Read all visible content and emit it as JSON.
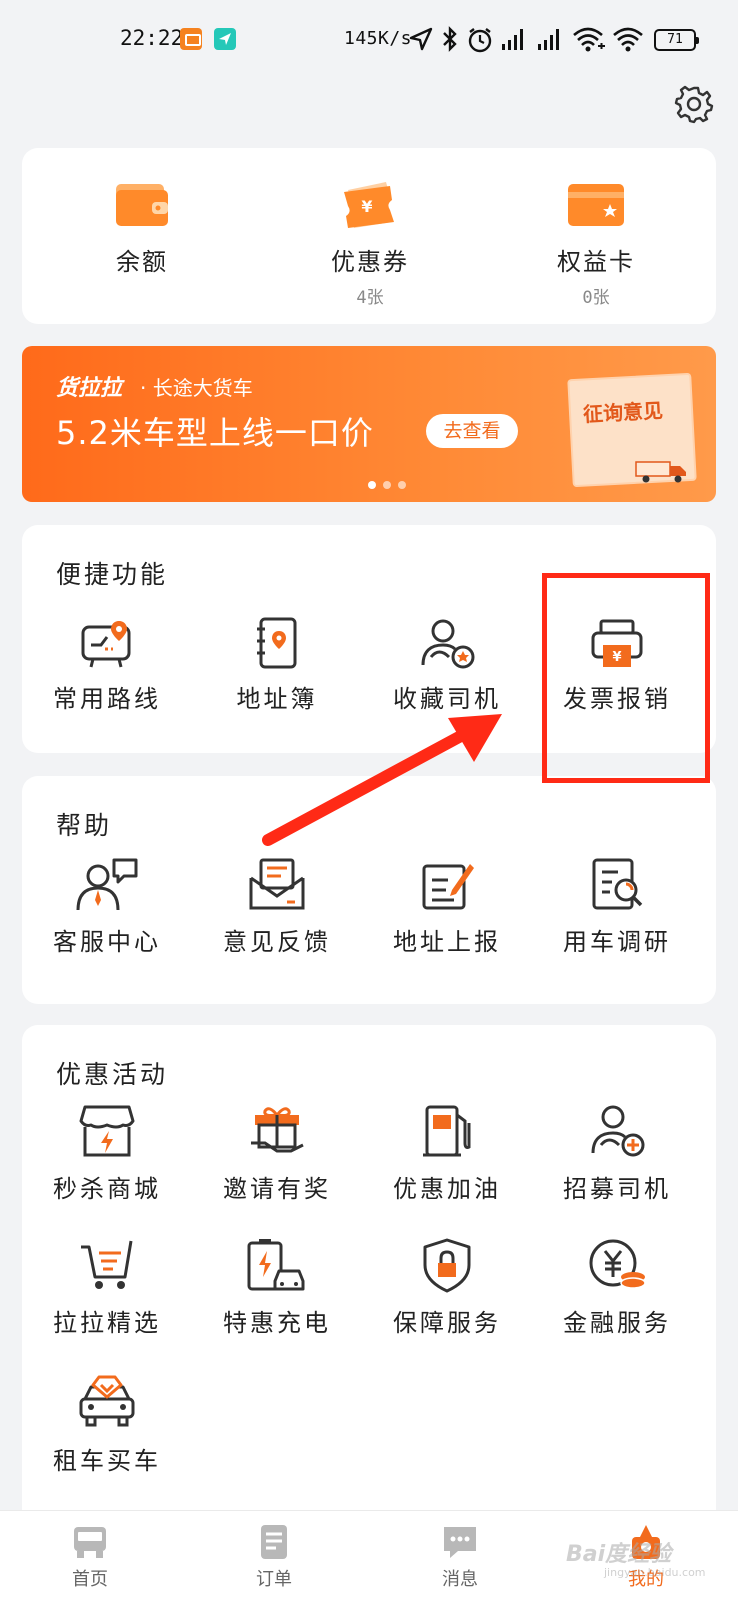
{
  "status_bar": {
    "time": "22:22",
    "net_speed": "145K/s",
    "battery": "71"
  },
  "wallet": {
    "items": [
      {
        "label": "余额",
        "sub": ""
      },
      {
        "label": "优惠券",
        "sub": "4张"
      },
      {
        "label": "权益卡",
        "sub": "0张"
      }
    ]
  },
  "banner": {
    "brand": "货拉拉",
    "subtitle": "· 长途大货车",
    "title": "5.2米车型上线一口价",
    "button": "去查看",
    "doc_text": "征询意见"
  },
  "quick": {
    "title": "便捷功能",
    "items": [
      {
        "label": "常用路线",
        "icon": "route-map-icon"
      },
      {
        "label": "地址簿",
        "icon": "address-book-icon"
      },
      {
        "label": "收藏司机",
        "icon": "favorite-driver-icon"
      },
      {
        "label": "发票报销",
        "icon": "invoice-printer-icon"
      }
    ]
  },
  "help": {
    "title": "帮助",
    "items": [
      {
        "label": "客服中心",
        "icon": "customer-service-icon"
      },
      {
        "label": "意见反馈",
        "icon": "feedback-envelope-icon"
      },
      {
        "label": "地址上报",
        "icon": "address-report-icon"
      },
      {
        "label": "用车调研",
        "icon": "survey-icon"
      }
    ]
  },
  "promo": {
    "title": "优惠活动",
    "items": [
      {
        "label": "秒杀商城",
        "icon": "flash-sale-store-icon"
      },
      {
        "label": "邀请有奖",
        "icon": "gift-icon"
      },
      {
        "label": "优惠加油",
        "icon": "fuel-pump-icon"
      },
      {
        "label": "招募司机",
        "icon": "recruit-driver-icon"
      },
      {
        "label": "拉拉精选",
        "icon": "shopping-cart-icon"
      },
      {
        "label": "特惠充电",
        "icon": "ev-charge-icon"
      },
      {
        "label": "保障服务",
        "icon": "shield-lock-icon"
      },
      {
        "label": "金融服务",
        "icon": "finance-coin-icon"
      },
      {
        "label": "租车买车",
        "icon": "car-rental-icon"
      }
    ]
  },
  "tabbar": {
    "tabs": [
      {
        "label": "首页",
        "icon": "truck-home-icon"
      },
      {
        "label": "订单",
        "icon": "order-list-icon"
      },
      {
        "label": "消息",
        "icon": "message-bubble-icon"
      },
      {
        "label": "我的",
        "icon": "profile-icon",
        "active": true
      }
    ]
  },
  "watermark": {
    "text": "Bai度经验",
    "sub": "jingyan.baidu.com"
  },
  "colors": {
    "accent": "#f26b1d",
    "highlight": "#ff2a16",
    "background": "#f2f3f5"
  }
}
